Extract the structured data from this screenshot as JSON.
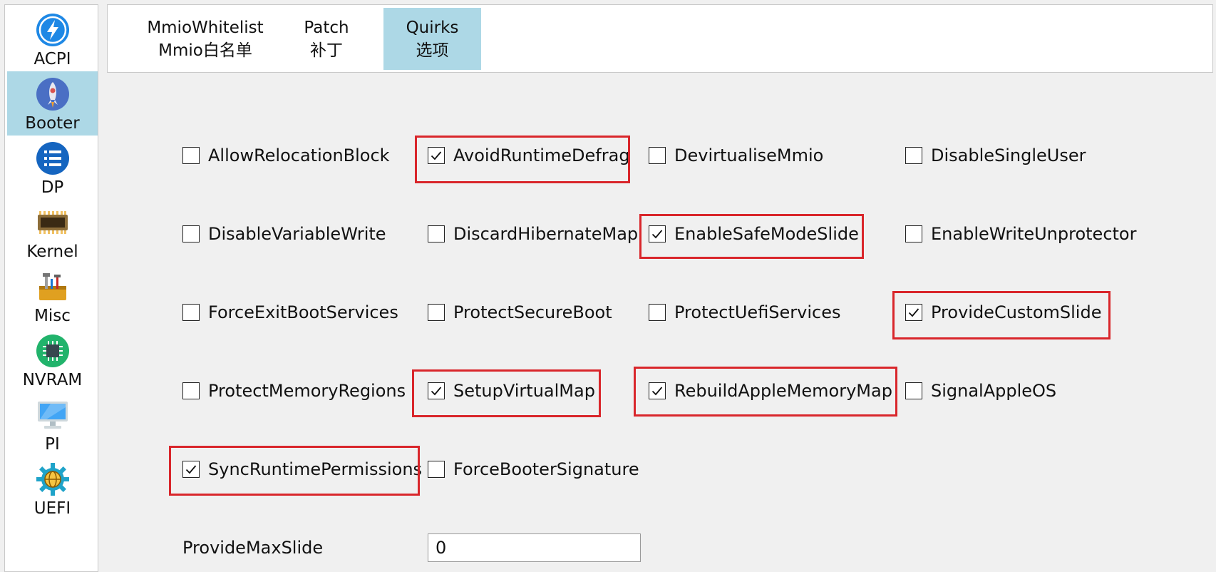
{
  "sidebar": {
    "items": [
      {
        "label": "ACPI",
        "icon": "acpi-bolt-icon"
      },
      {
        "label": "Booter",
        "icon": "booter-rocket-icon",
        "active": true
      },
      {
        "label": "DP",
        "icon": "dp-list-icon"
      },
      {
        "label": "Kernel",
        "icon": "kernel-chip-icon"
      },
      {
        "label": "Misc",
        "icon": "misc-toolbox-icon"
      },
      {
        "label": "NVRAM",
        "icon": "nvram-chip-icon"
      },
      {
        "label": "PI",
        "icon": "pi-monitor-icon"
      },
      {
        "label": "UEFI",
        "icon": "uefi-globe-gear-icon"
      }
    ]
  },
  "tabs": [
    {
      "line1": "MmioWhitelist",
      "line2": "Mmio白名单"
    },
    {
      "line1": "Patch",
      "line2": "补丁"
    },
    {
      "line1": "Quirks",
      "line2": "选项",
      "active": true
    }
  ],
  "quirks": [
    {
      "label": "AllowRelocationBlock",
      "checked": false,
      "highlighted": false
    },
    {
      "label": "AvoidRuntimeDefrag",
      "checked": true,
      "highlighted": true
    },
    {
      "label": "DevirtualiseMmio",
      "checked": false,
      "highlighted": false
    },
    {
      "label": "DisableSingleUser",
      "checked": false,
      "highlighted": false
    },
    {
      "label": "DisableVariableWrite",
      "checked": false,
      "highlighted": false
    },
    {
      "label": "DiscardHibernateMap",
      "checked": false,
      "highlighted": false
    },
    {
      "label": "EnableSafeModeSlide",
      "checked": true,
      "highlighted": true
    },
    {
      "label": "EnableWriteUnprotector",
      "checked": false,
      "highlighted": false
    },
    {
      "label": "ForceExitBootServices",
      "checked": false,
      "highlighted": false
    },
    {
      "label": "ProtectSecureBoot",
      "checked": false,
      "highlighted": false
    },
    {
      "label": "ProtectUefiServices",
      "checked": false,
      "highlighted": false
    },
    {
      "label": "ProvideCustomSlide",
      "checked": true,
      "highlighted": true
    },
    {
      "label": "ProtectMemoryRegions",
      "checked": false,
      "highlighted": false
    },
    {
      "label": "SetupVirtualMap",
      "checked": true,
      "highlighted": true
    },
    {
      "label": "RebuildAppleMemoryMap",
      "checked": true,
      "highlighted": true
    },
    {
      "label": "SignalAppleOS",
      "checked": false,
      "highlighted": false
    },
    {
      "label": "SyncRuntimePermissions",
      "checked": true,
      "highlighted": true
    },
    {
      "label": "ForceBooterSignature",
      "checked": false,
      "highlighted": false
    }
  ],
  "provide_max_slide": {
    "label": "ProvideMaxSlide",
    "value": "0"
  },
  "colors": {
    "accent": "#add8e6",
    "highlight_border": "#d9262b",
    "background": "#f0f0f0"
  }
}
